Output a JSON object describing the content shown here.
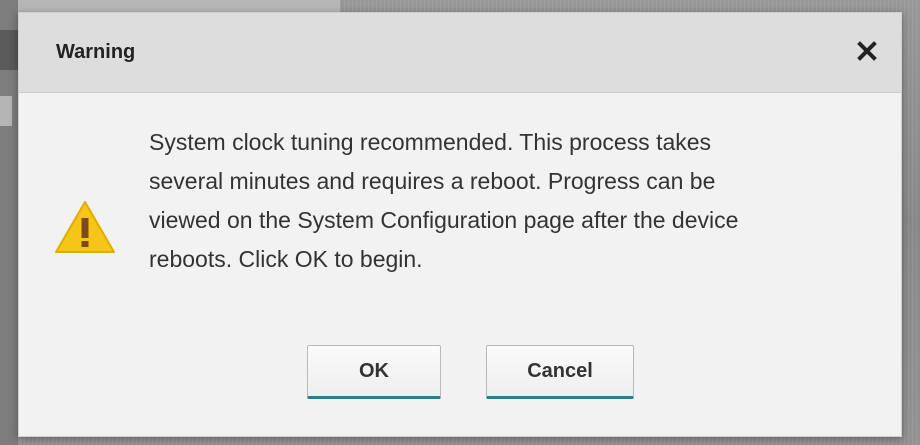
{
  "dialog": {
    "title": "Warning",
    "message": "System clock tuning recommended. This process takes\nseveral minutes and requires a reboot. Progress can be\nviewed on the System Configuration page after the device\nreboots. Click OK to begin.",
    "icons": {
      "close": "close-icon",
      "warning": "warning-icon"
    },
    "buttons": {
      "ok_label": "OK",
      "cancel_label": "Cancel"
    },
    "colors": {
      "header_bg": "#dddddd",
      "body_bg": "#f2f2f2",
      "warning_yellow": "#f5c518",
      "button_accent": "#2e7a96"
    }
  }
}
